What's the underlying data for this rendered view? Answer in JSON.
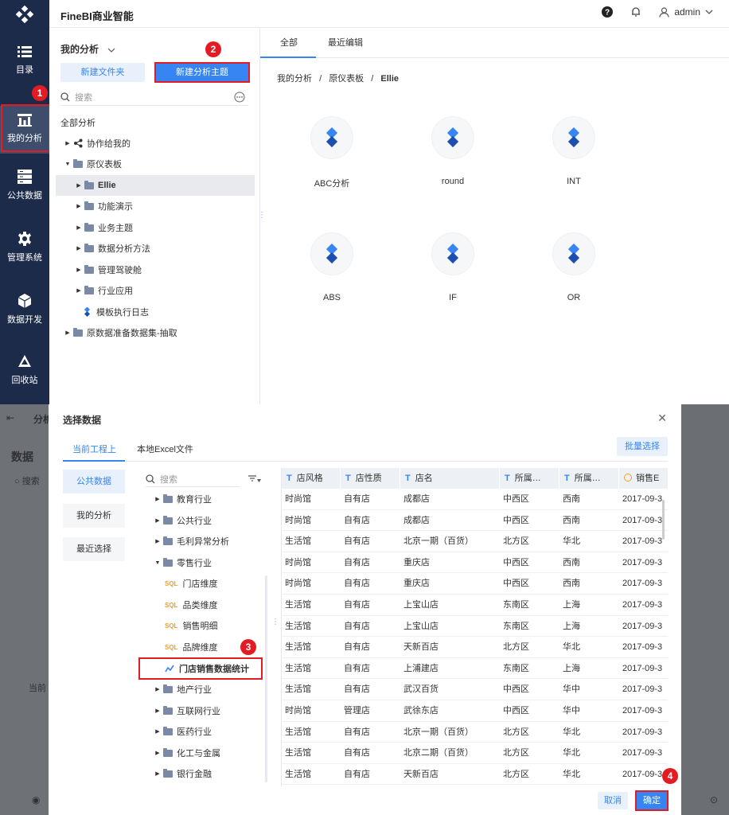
{
  "header": {
    "title": "FineBI商业智能",
    "user": "admin"
  },
  "nav": {
    "items": [
      {
        "label": "目录"
      },
      {
        "label": "我的分析"
      },
      {
        "label": "公共数据"
      },
      {
        "label": "管理系统"
      },
      {
        "label": "数据开发"
      },
      {
        "label": "回收站"
      }
    ]
  },
  "tree": {
    "title": "我的分析",
    "new_folder": "新建文件夹",
    "new_theme": "新建分析主题",
    "search_placeholder": "搜索",
    "root": "全部分析",
    "items": [
      {
        "label": "协作给我的"
      },
      {
        "label": "原仪表板"
      },
      {
        "label": "Ellie"
      },
      {
        "label": "功能演示"
      },
      {
        "label": "业务主题"
      },
      {
        "label": "数据分析方法"
      },
      {
        "label": "管理驾驶舱"
      },
      {
        "label": "行业应用"
      },
      {
        "label": "模板执行日志"
      },
      {
        "label": "原数据准备数据集-抽取"
      }
    ]
  },
  "main": {
    "tabs": [
      {
        "label": "全部"
      },
      {
        "label": "最近编辑"
      }
    ],
    "breadcrumb": {
      "a": "我的分析",
      "sep": "/",
      "b": "原仪表板",
      "c": "Ellie"
    },
    "cards": [
      {
        "label": "ABC分析"
      },
      {
        "label": "round"
      },
      {
        "label": "INT"
      },
      {
        "label": "ABS"
      },
      {
        "label": "IF"
      },
      {
        "label": "OR"
      }
    ]
  },
  "background": {
    "tab": "分析",
    "section": "数据",
    "search": "搜索",
    "hint": "当前"
  },
  "badges": [
    "1",
    "2",
    "3",
    "4"
  ],
  "modal": {
    "title": "选择数据",
    "tabs": [
      {
        "label": "当前工程上"
      },
      {
        "label": "本地Excel文件"
      }
    ],
    "batch_select": "批量选择",
    "sources": [
      {
        "label": "公共数据"
      },
      {
        "label": "我的分析"
      },
      {
        "label": "最近选择"
      }
    ],
    "search_placeholder": "搜索",
    "tree": [
      {
        "label": "教育行业"
      },
      {
        "label": "公共行业"
      },
      {
        "label": "毛利异常分析"
      },
      {
        "label": "零售行业"
      },
      {
        "label": "门店维度"
      },
      {
        "label": "品类维度"
      },
      {
        "label": "销售明细"
      },
      {
        "label": "品牌维度"
      },
      {
        "label": "门店销售数据统计"
      },
      {
        "label": "地产行业"
      },
      {
        "label": "互联网行业"
      },
      {
        "label": "医药行业"
      },
      {
        "label": "化工与金属"
      },
      {
        "label": "银行金融"
      }
    ],
    "sql_tag": "SQL",
    "columns": [
      "店风格",
      "店性质",
      "店名",
      "所属…",
      "所属…",
      "销售E"
    ],
    "rows": [
      [
        "时尚馆",
        "自有店",
        "成都店",
        "中西区",
        "西南",
        "2017-09-3"
      ],
      [
        "时尚馆",
        "自有店",
        "成都店",
        "中西区",
        "西南",
        "2017-09-3"
      ],
      [
        "生活馆",
        "自有店",
        "北京一期（百货）",
        "北方区",
        "华北",
        "2017-09-3"
      ],
      [
        "时尚馆",
        "自有店",
        "重庆店",
        "中西区",
        "西南",
        "2017-09-3"
      ],
      [
        "时尚馆",
        "自有店",
        "重庆店",
        "中西区",
        "西南",
        "2017-09-3"
      ],
      [
        "生活馆",
        "自有店",
        "上宝山店",
        "东南区",
        "上海",
        "2017-09-3"
      ],
      [
        "生活馆",
        "自有店",
        "上宝山店",
        "东南区",
        "上海",
        "2017-09-3"
      ],
      [
        "生活馆",
        "自有店",
        "天新百店",
        "北方区",
        "华北",
        "2017-09-3"
      ],
      [
        "生活馆",
        "自有店",
        "上浦建店",
        "东南区",
        "上海",
        "2017-09-3"
      ],
      [
        "生活馆",
        "自有店",
        "武汉百货",
        "中西区",
        "华中",
        "2017-09-3"
      ],
      [
        "时尚馆",
        "管理店",
        "武徐东店",
        "中西区",
        "华中",
        "2017-09-3"
      ],
      [
        "生活馆",
        "自有店",
        "北京一期（百货）",
        "北方区",
        "华北",
        "2017-09-3"
      ],
      [
        "生活馆",
        "自有店",
        "北京二期（百货）",
        "北方区",
        "华北",
        "2017-09-3"
      ],
      [
        "生活馆",
        "自有店",
        "天新百店",
        "北方区",
        "华北",
        "2017-09-3"
      ]
    ],
    "cancel": "取消",
    "ok": "确定"
  }
}
